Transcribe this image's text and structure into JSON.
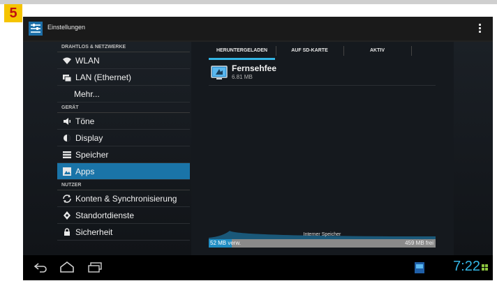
{
  "step_badge": "5",
  "actionbar": {
    "title": "Einstellungen"
  },
  "sections": {
    "wireless": "DRAHTLOS & NETZWERKE",
    "device": "GERÄT",
    "user": "NUTZER"
  },
  "menu": {
    "wlan": "WLAN",
    "lan": "LAN (Ethernet)",
    "more": "Mehr...",
    "sound": "Töne",
    "display": "Display",
    "storage": "Speicher",
    "apps": "Apps",
    "accounts": "Konten & Synchronisierung",
    "location": "Standortdienste",
    "security": "Sicherheit"
  },
  "tabs": [
    {
      "label": "HERUNTERGELADEN",
      "active": true
    },
    {
      "label": "AUF SD-KARTE",
      "active": false
    },
    {
      "label": "AKTIV",
      "active": false
    }
  ],
  "apps_list": [
    {
      "name": "Fernsehfee",
      "size": "6.81 MB"
    }
  ],
  "storage": {
    "label": "Interner Speicher",
    "used_value": "52 MB",
    "used_suffix": " verw.",
    "free": "459 MB frei",
    "used_fraction": 0.1
  },
  "status": {
    "clock": "7:22"
  },
  "colors": {
    "accent": "#33b5e5",
    "selected_item": "#1a74a8",
    "badge_bg": "#f5c400",
    "badge_fg": "#c01010"
  },
  "icons": {
    "wlan": "wifi-icon",
    "lan": "ethernet-icon",
    "sound": "speaker-icon",
    "display": "brightness-icon",
    "storage": "storage-icon",
    "apps": "apps-icon",
    "accounts": "sync-icon",
    "location": "location-icon",
    "security": "lock-icon"
  }
}
